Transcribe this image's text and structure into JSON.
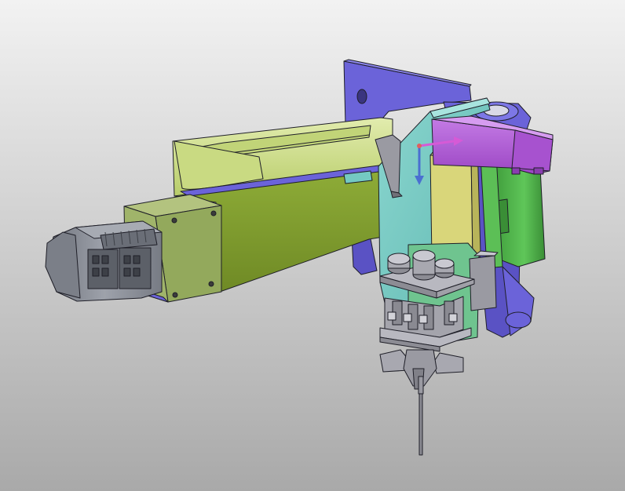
{
  "viewport": {
    "background_top": "#f2f2f2",
    "background_bottom": "#a9a9a9"
  },
  "palette": {
    "back_plate": "#6b63d9",
    "arm_top": "#cfe08a",
    "arm_side": "#7f9a2f",
    "end_cap": "#93a95c",
    "motor_body": "#8b8f99",
    "motor_dark": "#5c6068",
    "cyan_plate": "#74c9c2",
    "yellow_block": "#d9d67a",
    "purple_motor": "#b05cd6",
    "green_motor": "#4fb24a",
    "gray_parts": "#b8b8c0",
    "metal_dark": "#808088",
    "outline": "#1f1f28",
    "triad_x": "#d65ad6",
    "triad_z": "#4a6fd1"
  },
  "triad": {
    "x_axis_icon": "arrow-right-icon",
    "y_axis_icon": "arrow-down-icon"
  }
}
